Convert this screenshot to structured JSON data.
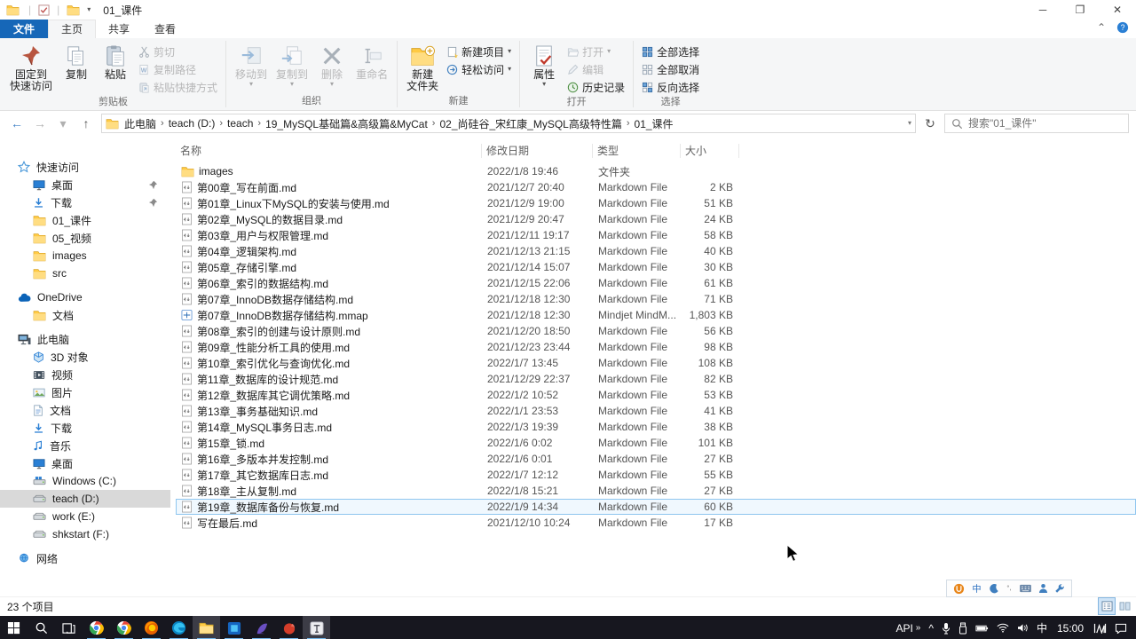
{
  "colors": {
    "accent": "#1667b8",
    "taskbar": "#17171f",
    "selection_gray": "#d9d9d9",
    "hover_blue_border": "#8fc6ef",
    "run_indicator": "#76b9ed"
  },
  "window": {
    "title": "01_课件"
  },
  "tabs": {
    "file": "文件",
    "home": "主页",
    "share": "共享",
    "view": "查看"
  },
  "ribbon": {
    "groups": [
      {
        "label": "剪贴板",
        "big": [
          {
            "icon": "pin-big",
            "label": "固定到\n快速访问"
          },
          {
            "icon": "copy-big",
            "label": "复制"
          },
          {
            "icon": "paste-big",
            "label": "粘贴"
          }
        ],
        "small": [
          {
            "icon": "cut-icon",
            "label": "剪切",
            "disabled": true
          },
          {
            "icon": "copypath-icon",
            "label": "复制路径",
            "disabled": true
          },
          {
            "icon": "pasteshortcut-icon",
            "label": "粘贴快捷方式",
            "disabled": true
          }
        ]
      },
      {
        "label": "组织",
        "big": [
          {
            "icon": "moveto-big",
            "label": "移动到",
            "menu": true,
            "disabled": true
          },
          {
            "icon": "copyto-big",
            "label": "复制到",
            "menu": true,
            "disabled": true
          },
          {
            "icon": "delete-big",
            "label": "删除",
            "menu": true,
            "disabled": true
          },
          {
            "icon": "rename-big",
            "label": "重命名",
            "disabled": true
          }
        ],
        "small": []
      },
      {
        "label": "新建",
        "big": [
          {
            "icon": "newfolder-big",
            "label": "新建\n文件夹"
          }
        ],
        "small": [
          {
            "icon": "newitem-icon",
            "label": "新建项目",
            "menu": true
          },
          {
            "icon": "easyaccess-icon",
            "label": "轻松访问",
            "menu": true
          }
        ]
      },
      {
        "label": "打开",
        "big": [
          {
            "icon": "properties-big",
            "label": "属性",
            "menu": true
          }
        ],
        "small": [
          {
            "icon": "open-icon",
            "label": "打开",
            "menu": true,
            "disabled": true
          },
          {
            "icon": "edit-icon",
            "label": "编辑",
            "disabled": true
          },
          {
            "icon": "history-icon",
            "label": "历史记录"
          }
        ]
      },
      {
        "label": "选择",
        "big": [],
        "small": [
          {
            "icon": "selectall-icon",
            "label": "全部选择"
          },
          {
            "icon": "selectnone-icon",
            "label": "全部取消"
          },
          {
            "icon": "invert-icon",
            "label": "反向选择"
          }
        ]
      }
    ]
  },
  "breadcrumb": {
    "segments": [
      "此电脑",
      "teach (D:)",
      "teach",
      "19_MySQL基础篇&高级篇&MyCat",
      "02_尚硅谷_宋红康_MySQL高级特性篇",
      "01_课件"
    ]
  },
  "search": {
    "placeholder": "搜索\"01_课件\""
  },
  "sidebar": {
    "sections": [
      {
        "label": "快速访问",
        "icon": "star-icon",
        "items": [
          {
            "label": "桌面",
            "icon": "desktop-icon",
            "pinned": true
          },
          {
            "label": "下载",
            "icon": "download-icon",
            "pinned": true
          },
          {
            "label": "01_课件",
            "icon": "folder-icon"
          },
          {
            "label": "05_视频",
            "icon": "folder-icon"
          },
          {
            "label": "images",
            "icon": "folder-icon"
          },
          {
            "label": "src",
            "icon": "folder-icon"
          }
        ]
      },
      {
        "label": "OneDrive",
        "icon": "cloud-icon",
        "items": [
          {
            "label": "文档",
            "icon": "folder-icon"
          }
        ]
      },
      {
        "label": "此电脑",
        "icon": "pc-icon",
        "items": [
          {
            "label": "3D 对象",
            "icon": "objects3d-icon"
          },
          {
            "label": "视频",
            "icon": "video-icon"
          },
          {
            "label": "图片",
            "icon": "picture-icon"
          },
          {
            "label": "文档",
            "icon": "document-icon"
          },
          {
            "label": "下载",
            "icon": "download-icon"
          },
          {
            "label": "音乐",
            "icon": "music-icon"
          },
          {
            "label": "桌面",
            "icon": "desktop-icon"
          },
          {
            "label": "Windows (C:)",
            "icon": "drive-win-icon"
          },
          {
            "label": "teach (D:)",
            "icon": "drive-icon",
            "selected": true
          },
          {
            "label": "work (E:)",
            "icon": "drive-icon"
          },
          {
            "label": "shkstart (F:)",
            "icon": "drive-icon"
          }
        ]
      },
      {
        "label": "网络",
        "icon": "network-icon",
        "items": []
      }
    ]
  },
  "file_list": {
    "columns": {
      "name": "名称",
      "date": "修改日期",
      "type": "类型",
      "size": "大小"
    },
    "rows": [
      {
        "name": "images",
        "date": "2022/1/8 19:46",
        "type": "文件夹",
        "size": "",
        "icon": "folder-icon"
      },
      {
        "name": "第00章_写在前面.md",
        "date": "2021/12/7 20:40",
        "type": "Markdown File",
        "size": "2 KB",
        "icon": "md-icon"
      },
      {
        "name": "第01章_Linux下MySQL的安装与使用.md",
        "date": "2021/12/9 19:00",
        "type": "Markdown File",
        "size": "51 KB",
        "icon": "md-icon"
      },
      {
        "name": "第02章_MySQL的数据目录.md",
        "date": "2021/12/9 20:47",
        "type": "Markdown File",
        "size": "24 KB",
        "icon": "md-icon"
      },
      {
        "name": "第03章_用户与权限管理.md",
        "date": "2021/12/11 19:17",
        "type": "Markdown File",
        "size": "58 KB",
        "icon": "md-icon"
      },
      {
        "name": "第04章_逻辑架构.md",
        "date": "2021/12/13 21:15",
        "type": "Markdown File",
        "size": "40 KB",
        "icon": "md-icon"
      },
      {
        "name": "第05章_存储引擎.md",
        "date": "2021/12/14 15:07",
        "type": "Markdown File",
        "size": "30 KB",
        "icon": "md-icon"
      },
      {
        "name": "第06章_索引的数据结构.md",
        "date": "2021/12/15 22:06",
        "type": "Markdown File",
        "size": "61 KB",
        "icon": "md-icon"
      },
      {
        "name": "第07章_InnoDB数据存储结构.md",
        "date": "2021/12/18 12:30",
        "type": "Markdown File",
        "size": "71 KB",
        "icon": "md-icon"
      },
      {
        "name": "第07章_InnoDB数据存储结构.mmap",
        "date": "2021/12/18 12:30",
        "type": "Mindjet MindM...",
        "size": "1,803 KB",
        "icon": "mmap-icon"
      },
      {
        "name": "第08章_索引的创建与设计原则.md",
        "date": "2021/12/20 18:50",
        "type": "Markdown File",
        "size": "56 KB",
        "icon": "md-icon"
      },
      {
        "name": "第09章_性能分析工具的使用.md",
        "date": "2021/12/23 23:44",
        "type": "Markdown File",
        "size": "98 KB",
        "icon": "md-icon"
      },
      {
        "name": "第10章_索引优化与查询优化.md",
        "date": "2022/1/7 13:45",
        "type": "Markdown File",
        "size": "108 KB",
        "icon": "md-icon"
      },
      {
        "name": "第11章_数据库的设计规范.md",
        "date": "2021/12/29 22:37",
        "type": "Markdown File",
        "size": "82 KB",
        "icon": "md-icon"
      },
      {
        "name": "第12章_数据库其它调优策略.md",
        "date": "2022/1/2 10:52",
        "type": "Markdown File",
        "size": "53 KB",
        "icon": "md-icon"
      },
      {
        "name": "第13章_事务基础知识.md",
        "date": "2022/1/1 23:53",
        "type": "Markdown File",
        "size": "41 KB",
        "icon": "md-icon"
      },
      {
        "name": "第14章_MySQL事务日志.md",
        "date": "2022/1/3 19:39",
        "type": "Markdown File",
        "size": "38 KB",
        "icon": "md-icon"
      },
      {
        "name": "第15章_锁.md",
        "date": "2022/1/6 0:02",
        "type": "Markdown File",
        "size": "101 KB",
        "icon": "md-icon"
      },
      {
        "name": "第16章_多版本并发控制.md",
        "date": "2022/1/6 0:01",
        "type": "Markdown File",
        "size": "27 KB",
        "icon": "md-icon"
      },
      {
        "name": "第17章_其它数据库日志.md",
        "date": "2022/1/7 12:12",
        "type": "Markdown File",
        "size": "55 KB",
        "icon": "md-icon"
      },
      {
        "name": "第18章_主从复制.md",
        "date": "2022/1/8 15:21",
        "type": "Markdown File",
        "size": "27 KB",
        "icon": "md-icon"
      },
      {
        "name": "第19章_数据库备份与恢复.md",
        "date": "2022/1/9 14:34",
        "type": "Markdown File",
        "size": "60 KB",
        "icon": "md-icon",
        "hover": true
      },
      {
        "name": "写在最后.md",
        "date": "2021/12/10 10:24",
        "type": "Markdown File",
        "size": "17 KB",
        "icon": "md-icon"
      }
    ]
  },
  "status_bar": {
    "items_count": "23 个项目"
  },
  "ime_bar": {
    "icons": [
      "ime-logo-icon",
      "ime-cn-icon",
      "ime-moon-icon",
      "ime-punct-icon",
      "ime-keyboard-icon",
      "ime-person-icon",
      "ime-wrench-icon"
    ]
  },
  "taskbar": {
    "apps": [
      {
        "id": "start-icon",
        "running": false
      },
      {
        "id": "taskbar-search-icon",
        "running": false
      },
      {
        "id": "task-view-icon",
        "running": false
      },
      {
        "id": "chrome-icon",
        "running": true
      },
      {
        "id": "chrome2-icon",
        "running": true
      },
      {
        "id": "firefox-icon",
        "running": true
      },
      {
        "id": "edge-icon",
        "running": true
      },
      {
        "id": "explorer-icon",
        "running": true,
        "active": true
      },
      {
        "id": "blueapp-icon",
        "running": true
      },
      {
        "id": "purpleapp-icon",
        "running": true
      },
      {
        "id": "redapp-icon",
        "running": true
      },
      {
        "id": "typora-icon",
        "running": true,
        "active": true
      }
    ],
    "tray": {
      "overflow_label": "API",
      "chevrons": "»",
      "hidden_arrow": "^",
      "ime_mode": "中",
      "time": "15:00"
    }
  }
}
